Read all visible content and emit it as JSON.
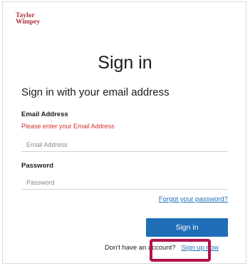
{
  "brand": {
    "logo_line1": "Taylor",
    "logo_line2": "Wimpey"
  },
  "heading": "Sign in",
  "subheading": "Sign in with your email address",
  "email": {
    "label": "Email Address",
    "error": "Please enter your Email Address",
    "placeholder": "Email Address",
    "value": ""
  },
  "password": {
    "label": "Password",
    "placeholder": "Password",
    "value": ""
  },
  "forgot_link": "Forgot your password?",
  "signin_button": "Sign in",
  "footer": {
    "prompt": "Don't have an account?",
    "signup_link": "Sign up now"
  },
  "colors": {
    "accent": "#1f6fb8",
    "error": "#d32f2f",
    "brand": "#b0303d",
    "highlight": "#b3124d"
  }
}
